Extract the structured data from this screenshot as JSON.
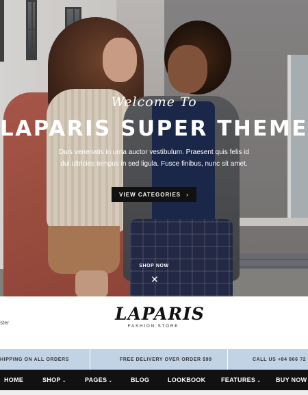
{
  "hero": {
    "welcome": "Welcome To",
    "headline": "LAPARIS SUPER THEME",
    "subtext": "Duis venenatis in urna auctor vestibulum. Praesent quis felis id dui ultricies tempus in sed ligula. Fusce finibus, nunc sit amet.",
    "cta_label": "VIEW CATEGORIES",
    "cta_icon": "chevron-right-icon",
    "shop_now": "SHOP NOW",
    "close_icon": "close-icon"
  },
  "header": {
    "register_partial": "ster",
    "logo_text": "LAPARIS",
    "logo_sub": "FASHION.STORE"
  },
  "infobar": {
    "color": "#c3d3e6",
    "items": [
      "HIPPING ON ALL ORDERS",
      "FREE DELIVERY OVER ORDER $99",
      "CALL US +84 866 72"
    ]
  },
  "nav": {
    "items": [
      {
        "label": "HOME",
        "dropdown": false
      },
      {
        "label": "SHOP",
        "dropdown": true
      },
      {
        "label": "PAGES",
        "dropdown": true
      },
      {
        "label": "BLOG",
        "dropdown": false
      },
      {
        "label": "LOOKBOOK",
        "dropdown": false
      },
      {
        "label": "FEATURES",
        "dropdown": true
      },
      {
        "label": "BUY NOW",
        "dropdown": false
      }
    ]
  }
}
